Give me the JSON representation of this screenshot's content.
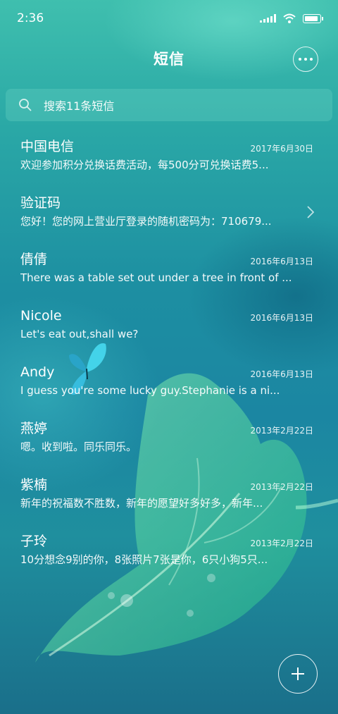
{
  "status_bar": {
    "time": "2:36",
    "icons": [
      "signal-icon",
      "wifi-icon",
      "battery-icon"
    ]
  },
  "header": {
    "title": "短信",
    "more_icon": "more-dots-icon"
  },
  "search": {
    "placeholder": "搜索11条短信",
    "icon": "search-icon"
  },
  "messages": [
    {
      "name": "中国电信",
      "date": "2017年6月30日",
      "preview": "欢迎参加积分兑换话费活动，每500分可兑换话费5..."
    },
    {
      "name": "验证码",
      "date": "",
      "preview": "您好！您的网上营业厅登录的随机密码为：710679..."
    },
    {
      "name": "倩倩",
      "date": "2016年6月13日",
      "preview": "There was a table set out under a tree in front of ..."
    },
    {
      "name": "Nicole",
      "date": "2016年6月13日",
      "preview": "Let's eat out,shall we?"
    },
    {
      "name": "Andy",
      "date": "2016年6月13日",
      "preview": "I guess you're some lucky guy.Stephanie is a ni..."
    },
    {
      "name": "燕婷",
      "date": "2013年2月22日",
      "preview": "嗯。收到啦。同乐同乐。"
    },
    {
      "name": "紫楠",
      "date": "2013年2月22日",
      "preview": "新年的祝福数不胜数，新年的愿望好多好多，新年..."
    },
    {
      "name": "子玲",
      "date": "2013年2月22日",
      "preview": "10分想念9别的你，8张照片7张是你，6只小狗5只..."
    }
  ],
  "fab": {
    "icon": "plus-icon"
  },
  "colors": {
    "accent": "#1d8fa2",
    "text": "#ffffff"
  }
}
